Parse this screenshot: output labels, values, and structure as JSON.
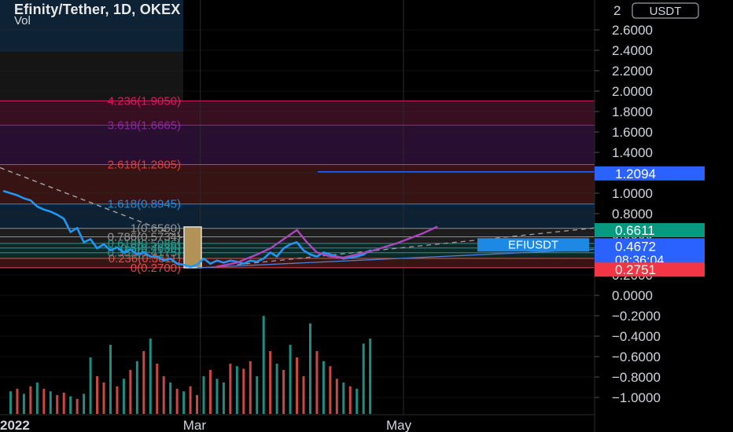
{
  "header": {
    "symbol_line": "Efinity/Tether, 1D, OKEX",
    "volume_label": "Vol"
  },
  "currency_badge": "USDT",
  "chart_data": {
    "type": "line",
    "y_axis": {
      "ylim": [
        -1.1,
        2.8
      ],
      "ticks": [
        2.6,
        2.4,
        2.2,
        2.0,
        1.8,
        1.6,
        1.4,
        1.2,
        1.0,
        0.8,
        0.6,
        0.4,
        0.2,
        0.0,
        -0.2,
        -0.4,
        -0.6,
        -0.8,
        -1.0
      ],
      "tick_labels": [
        "2.6000",
        "2.4000",
        "2.2000",
        "2.0000",
        "1.8000",
        "1.6000",
        "1.4000",
        "1.2000",
        "1.0000",
        "0.8000",
        "0.6000",
        "0.4000",
        "0.2000",
        "0.0000",
        "−0.2000",
        "−0.4000",
        "−0.6000",
        "−0.8000",
        "−1.0000"
      ],
      "top_partial_label": "2"
    },
    "x_axis": {
      "labels": [
        {
          "text": "2022",
          "day": 0
        },
        {
          "text": "Mar",
          "day": 59
        },
        {
          "text": "May",
          "day": 120
        }
      ],
      "xlim": [
        0,
        182
      ]
    },
    "fibonacci": {
      "base": 0.27,
      "top": 0.656,
      "levels": [
        {
          "ratio": 0,
          "price": 0.27,
          "label": "0(0.2700)",
          "color": "#ef5350"
        },
        {
          "ratio": 0.236,
          "price": 0.3611,
          "label": "0.236(0.3611)",
          "color": "#ef5350"
        },
        {
          "ratio": 0.382,
          "price": 0.4175,
          "label": "0.382(0.4175)",
          "color": "#26a69a"
        },
        {
          "ratio": 0.5,
          "price": 0.463,
          "label": "0.5(0.4630)",
          "color": "#26a69a"
        },
        {
          "ratio": 0.618,
          "price": 0.5086,
          "label": "0.618(0.5086)",
          "color": "#26a69a"
        },
        {
          "ratio": 0.786,
          "price": 0.5734,
          "label": "0.786(0.5734)",
          "color": "#9e9e9e"
        },
        {
          "ratio": 1,
          "price": 0.656,
          "label": "1(0.6560)",
          "color": "#9e9e9e"
        },
        {
          "ratio": 1.618,
          "price": 0.8945,
          "label": "1.618(0.8945)",
          "color": "#2196f3"
        },
        {
          "ratio": 2.618,
          "price": 1.2805,
          "label": "2.618(1.2805)",
          "color": "#f44336"
        },
        {
          "ratio": 3.618,
          "price": 1.6665,
          "label": "3.618(1.6665)",
          "color": "#9c27b0"
        },
        {
          "ratio": 4.236,
          "price": 1.905,
          "label": "4.236(1.9050)",
          "color": "#e91e63"
        }
      ]
    },
    "series": [
      {
        "name": "EFIUSDT",
        "color": "#2196f3",
        "x": [
          0,
          2,
          4,
          6,
          8,
          10,
          12,
          14,
          16,
          18,
          20,
          22,
          24,
          26,
          28,
          30,
          32,
          34,
          36,
          38,
          40,
          42,
          44,
          46,
          48,
          50,
          52,
          54,
          56,
          58,
          60,
          62,
          64,
          66,
          68,
          70,
          72,
          74,
          76,
          78,
          80,
          82,
          84,
          86,
          88,
          90,
          92,
          94,
          96,
          98,
          100,
          102,
          104,
          106,
          108,
          110
        ],
        "values": [
          1.02,
          1.0,
          0.98,
          0.95,
          0.93,
          0.87,
          0.84,
          0.82,
          0.79,
          0.75,
          0.62,
          0.66,
          0.52,
          0.55,
          0.46,
          0.5,
          0.44,
          0.47,
          0.42,
          0.45,
          0.4,
          0.42,
          0.38,
          0.38,
          0.34,
          0.36,
          0.31,
          0.3,
          0.28,
          0.3,
          0.36,
          0.31,
          0.34,
          0.32,
          0.34,
          0.33,
          0.31,
          0.34,
          0.33,
          0.36,
          0.42,
          0.38,
          0.46,
          0.5,
          0.52,
          0.44,
          0.4,
          0.38,
          0.42,
          0.4,
          0.38,
          0.36,
          0.37,
          0.38,
          0.4,
          0.44
        ]
      },
      {
        "name": "",
        "color": "#ab47bc",
        "x": [
          64,
          70,
          76,
          80,
          84,
          88,
          91,
          94,
          98,
          102,
          106,
          110,
          114,
          118,
          122,
          126,
          130
        ],
        "values": [
          0.28,
          0.32,
          0.4,
          0.46,
          0.55,
          0.64,
          0.52,
          0.42,
          0.38,
          0.37,
          0.4,
          0.43,
          0.47,
          0.51,
          0.56,
          0.61,
          0.67
        ]
      }
    ],
    "volume": {
      "x": [
        2,
        4,
        6,
        8,
        10,
        12,
        14,
        16,
        18,
        20,
        22,
        24,
        26,
        28,
        30,
        32,
        34,
        36,
        38,
        40,
        42,
        44,
        46,
        48,
        50,
        52,
        54,
        56,
        58,
        60,
        62,
        64,
        66,
        68,
        70,
        72,
        74,
        76,
        78,
        80,
        82,
        84,
        86,
        88,
        90,
        92,
        94,
        96,
        98,
        100,
        102,
        104,
        106,
        108,
        110
      ],
      "values": [
        0.18,
        0.2,
        0.16,
        0.22,
        0.25,
        0.2,
        0.18,
        0.15,
        0.17,
        0.14,
        0.12,
        0.16,
        0.45,
        0.3,
        0.25,
        0.55,
        0.22,
        0.28,
        0.35,
        0.42,
        0.5,
        0.6,
        0.4,
        0.3,
        0.25,
        0.2,
        0.18,
        0.22,
        0.15,
        0.3,
        0.35,
        0.28,
        0.25,
        0.4,
        0.38,
        0.36,
        0.42,
        0.3,
        0.78,
        0.5,
        0.4,
        0.35,
        0.55,
        0.45,
        0.3,
        0.72,
        0.5,
        0.42,
        0.38,
        0.28,
        0.25,
        0.22,
        0.2,
        0.56,
        0.6
      ],
      "up": [
        true,
        false,
        true,
        false,
        true,
        false,
        true,
        false,
        false,
        true,
        false,
        true,
        true,
        false,
        false,
        true,
        false,
        true,
        false,
        true,
        false,
        true,
        false,
        false,
        true,
        false,
        true,
        false,
        false,
        true,
        false,
        true,
        true,
        false,
        true,
        false,
        false,
        true,
        true,
        false,
        true,
        false,
        true,
        false,
        false,
        true,
        false,
        true,
        false,
        false,
        true,
        false,
        true,
        true,
        true
      ]
    },
    "price_labels": [
      {
        "text": "1.2094",
        "value": 1.2094,
        "color": "#2962ff"
      },
      {
        "text": "0.6611",
        "value": 0.6611,
        "color": "#089981"
      },
      {
        "text": "0.4672",
        "value": 0.4672,
        "color": "#2962ff"
      },
      {
        "text": "08:36:04",
        "color": "#2962ff"
      },
      {
        "text": "0.2751",
        "value": 0.2751,
        "color": "#f23645"
      }
    ],
    "symbol_tag": "EFIUSDT",
    "horizontal_ray": 1.2094,
    "colors": {
      "up": "#26a69a",
      "down": "#ef5350",
      "grid": "#2a2a2a",
      "axis_text": "#d1d4dc"
    }
  }
}
